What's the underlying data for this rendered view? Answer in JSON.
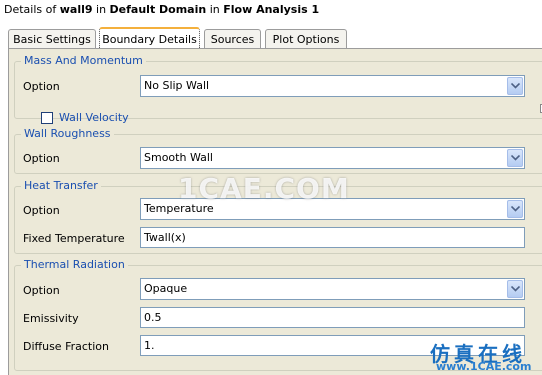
{
  "header": {
    "prefix": "Details of",
    "object_name": "wall9",
    "mid1": "in",
    "domain_name": "Default Domain",
    "mid2": "in",
    "analysis_name": "Flow Analysis 1"
  },
  "tabs": [
    "Basic Settings",
    "Boundary Details",
    "Sources",
    "Plot Options"
  ],
  "active_tab": "Boundary Details",
  "groups": {
    "mass_momentum": {
      "title": "Mass And Momentum",
      "option_label": "Option",
      "option_value": "No Slip Wall",
      "wall_velocity_label": "Wall Velocity",
      "wall_velocity_checked": false
    },
    "wall_roughness": {
      "title": "Wall Roughness",
      "option_label": "Option",
      "option_value": "Smooth Wall"
    },
    "heat_transfer": {
      "title": "Heat Transfer",
      "option_label": "Option",
      "option_value": "Temperature",
      "fixed_temp_label": "Fixed Temperature",
      "fixed_temp_value": "Twall(x)"
    },
    "thermal_radiation": {
      "title": "Thermal Radiation",
      "option_label": "Option",
      "option_value": "Opaque",
      "emissivity_label": "Emissivity",
      "emissivity_value": "0.5",
      "diffuse_label": "Diffuse Fraction",
      "diffuse_value": "1."
    }
  },
  "icons": {
    "dropdown": "chevron-down-icon",
    "expand": "plus-box-icon"
  },
  "watermarks": {
    "center": "1CAE.COM",
    "corner_cn": "仿真在线",
    "corner_url": "www.1CAE.com"
  },
  "colors": {
    "panel_bg": "#ece9d8",
    "group_title": "#1a4fb0",
    "active_tab_accent": "#f4b03c",
    "input_border": "#7f9db9"
  }
}
